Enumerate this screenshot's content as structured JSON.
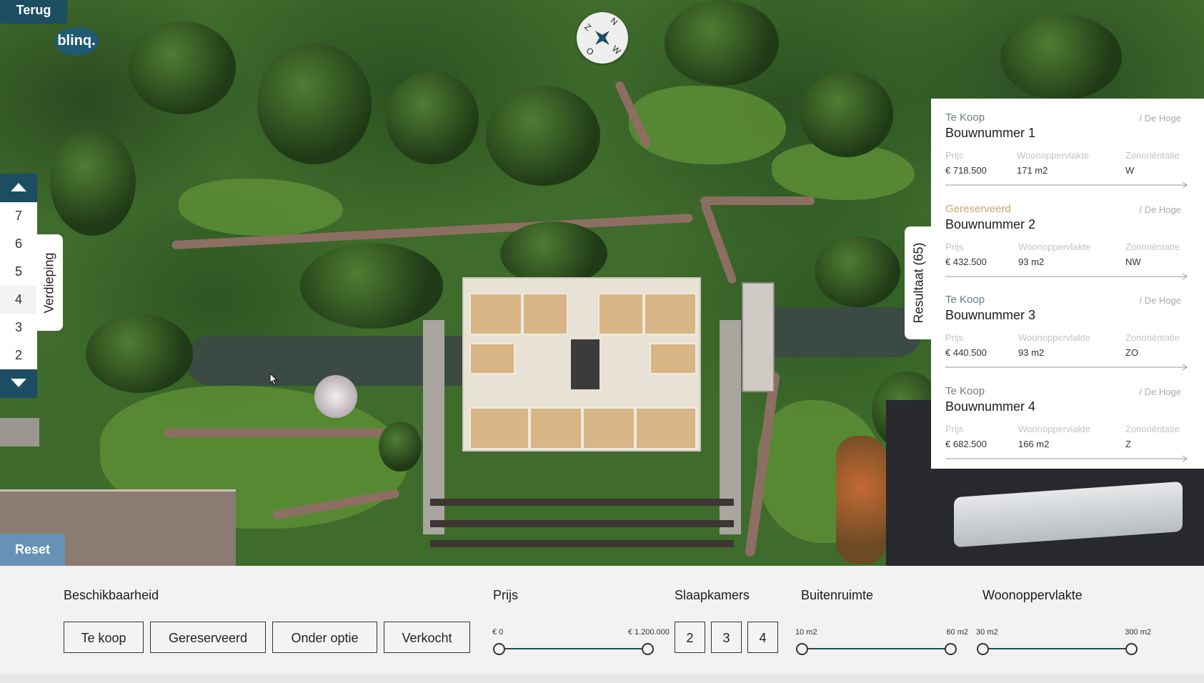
{
  "nav": {
    "back_label": "Terug",
    "logo_text": "blinq."
  },
  "compass": {
    "labels": [
      "N",
      "O",
      "Z",
      "W"
    ]
  },
  "floors": {
    "tab_label": "Verdieping",
    "items": [
      "7",
      "6",
      "5",
      "4",
      "3",
      "2"
    ],
    "active": "4"
  },
  "reset_label": "Reset",
  "results": {
    "tab_label": "Resultaat (65)",
    "columns": {
      "price": "Prijs",
      "area": "Woonoppervlakte",
      "orientation": "Zonoriëntatie"
    },
    "items": [
      {
        "status": "Te Koop",
        "project": "/ De Hoge",
        "name": "Bouwnummer 1",
        "price": "€ 718.500",
        "area": "171 m2",
        "orientation": "W"
      },
      {
        "status": "Gereserveerd",
        "project": "/ De Hoge",
        "name": "Bouwnummer 2",
        "price": "€ 432.500",
        "area": "93 m2",
        "orientation": "NW"
      },
      {
        "status": "Te Koop",
        "project": "/ De Hoge",
        "name": "Bouwnummer 3",
        "price": "€ 440.500",
        "area": "93 m2",
        "orientation": "ZO"
      },
      {
        "status": "Te Koop",
        "project": "/ De Hoge",
        "name": "Bouwnummer 4",
        "price": "€ 682.500",
        "area": "166 m2",
        "orientation": "Z"
      }
    ]
  },
  "filters": {
    "availability": {
      "heading": "Beschikbaarheid",
      "options": [
        "Te koop",
        "Gereserveerd",
        "Onder optie",
        "Verkocht"
      ]
    },
    "price": {
      "heading": "Prijs",
      "min_label": "€ 0",
      "max_label": "€ 1.200.000"
    },
    "bedrooms": {
      "heading": "Slaapkamers",
      "options": [
        "2",
        "3",
        "4"
      ]
    },
    "outdoor": {
      "heading": "Buitenruimte",
      "min_label": "10 m2",
      "max_label": "60 m2"
    },
    "living_area": {
      "heading": "Woonoppervlakte",
      "min_label": "30 m2",
      "max_label": "300 m2"
    }
  },
  "colors": {
    "brand": "#1c4d63",
    "reset": "#6892b5",
    "reserved": "#c9a66a"
  }
}
